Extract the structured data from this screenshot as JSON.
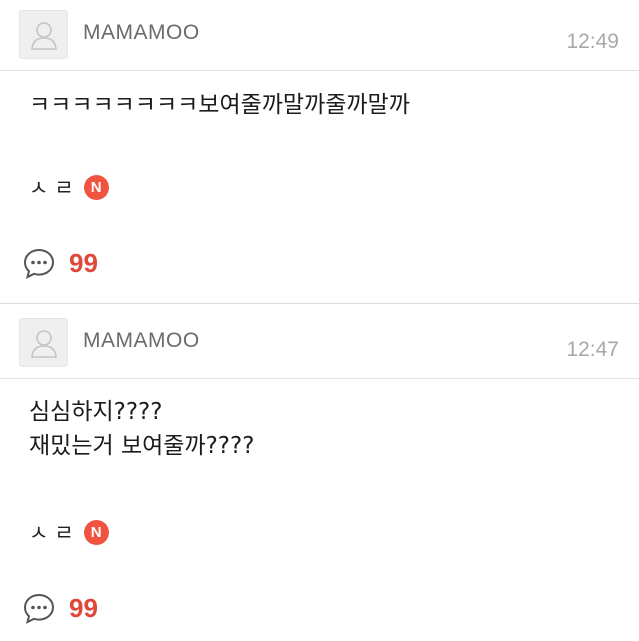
{
  "posts": [
    {
      "author": "MAMAMOO",
      "time": "12:49",
      "content": "ㅋㅋㅋㅋㅋㅋㅋㅋ보여줄까말까줄까말까",
      "signature": "ㅅㄹ",
      "badge": "N",
      "comment_count": "99",
      "avatar_icon": "default-profile-icon",
      "comment_icon": "speech-bubble-icon"
    },
    {
      "author": "MAMAMOO",
      "time": "12:47",
      "content": "심심하지????\n재밌는거 보여줄까????",
      "signature": "ㅅㄹ",
      "badge": "N",
      "comment_count": "99",
      "avatar_icon": "default-profile-icon",
      "comment_icon": "speech-bubble-icon"
    }
  ],
  "colors": {
    "badge": "#f0533f",
    "comment_count": "#e0483a",
    "time": "#a8a8a8",
    "author": "#6b6b6b"
  }
}
